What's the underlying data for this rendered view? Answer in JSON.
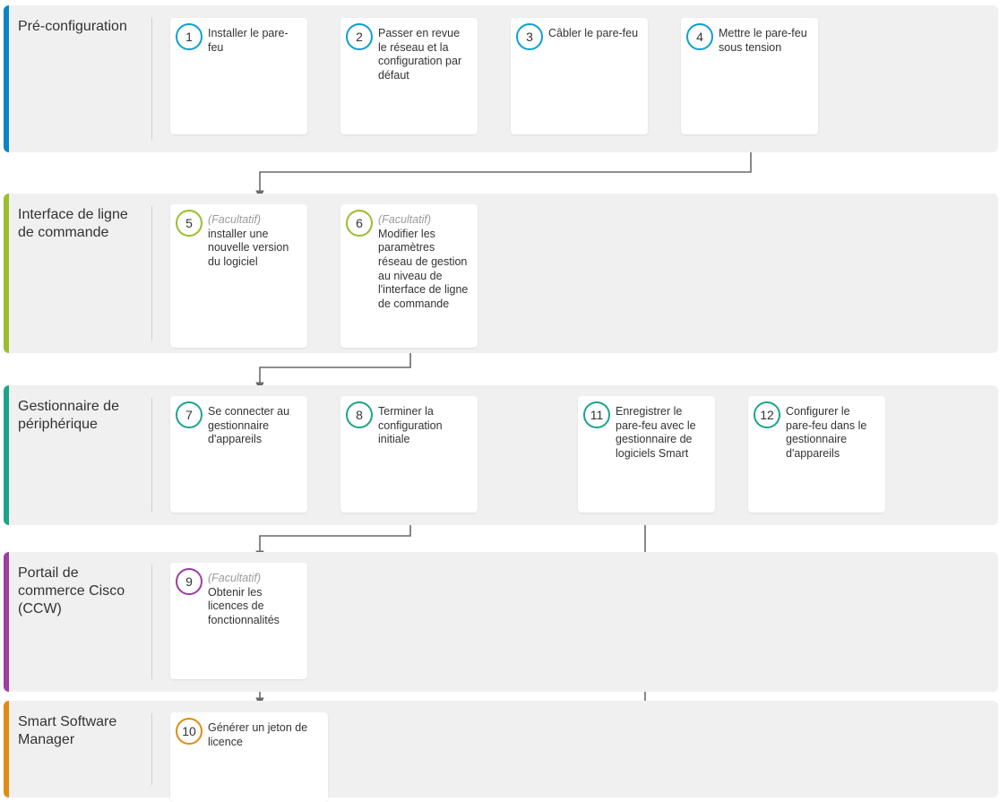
{
  "sections": {
    "pre": {
      "title": "Pré-configuration",
      "color": "#0a84c6"
    },
    "cli": {
      "title": "Interface de ligne de commande",
      "color": "#9bbd2e"
    },
    "devmgr": {
      "title": "Gestionnaire de périphérique",
      "color": "#1aa58a"
    },
    "ccw": {
      "title": "Portail de commerce Cisco (CCW)",
      "color": "#9b3fa0"
    },
    "ssm": {
      "title": "Smart Software Manager",
      "color": "#e28c0f"
    }
  },
  "steps": {
    "s1": {
      "num": "1",
      "text": "Installer le pare-feu",
      "badge_color": "#0ca0d4"
    },
    "s2": {
      "num": "2",
      "text": "Passer en revue le réseau et la configuration par défaut",
      "badge_color": "#0ca0d4"
    },
    "s3": {
      "num": "3",
      "text": "Câbler le pare-feu",
      "badge_color": "#0ca0d4"
    },
    "s4": {
      "num": "4",
      "text": "Mettre le pare-feu sous tension",
      "badge_color": "#0ca0d4"
    },
    "s5": {
      "num": "5",
      "optional": "(Facultatif)",
      "text": "installer une nouvelle version du logiciel",
      "badge_color": "#9bbd2e"
    },
    "s6": {
      "num": "6",
      "optional": "(Facultatif)",
      "text": "Modifier les paramètres réseau de gestion au niveau de l'interface de ligne de commande",
      "badge_color": "#9bbd2e"
    },
    "s7": {
      "num": "7",
      "text": "Se connecter au gestionnaire d'appareils",
      "badge_color": "#1aa58a"
    },
    "s8": {
      "num": "8",
      "text": "Terminer la configuration initiale",
      "badge_color": "#1aa58a"
    },
    "s9": {
      "num": "9",
      "optional": "(Facultatif)",
      "text": "Obtenir les licences de fonctionnalités",
      "badge_color": "#9b3fa0"
    },
    "s10": {
      "num": "10",
      "text": "Générer un jeton de licence",
      "badge_color": "#e28c0f"
    },
    "s11": {
      "num": "11",
      "text": "Enregistrer le pare-feu avec le gestionnaire de logiciels Smart",
      "badge_color": "#1aa58a"
    },
    "s12": {
      "num": "12",
      "text": "Configurer le pare-feu dans le gestionnaire d'appareils",
      "badge_color": "#1aa58a"
    }
  }
}
